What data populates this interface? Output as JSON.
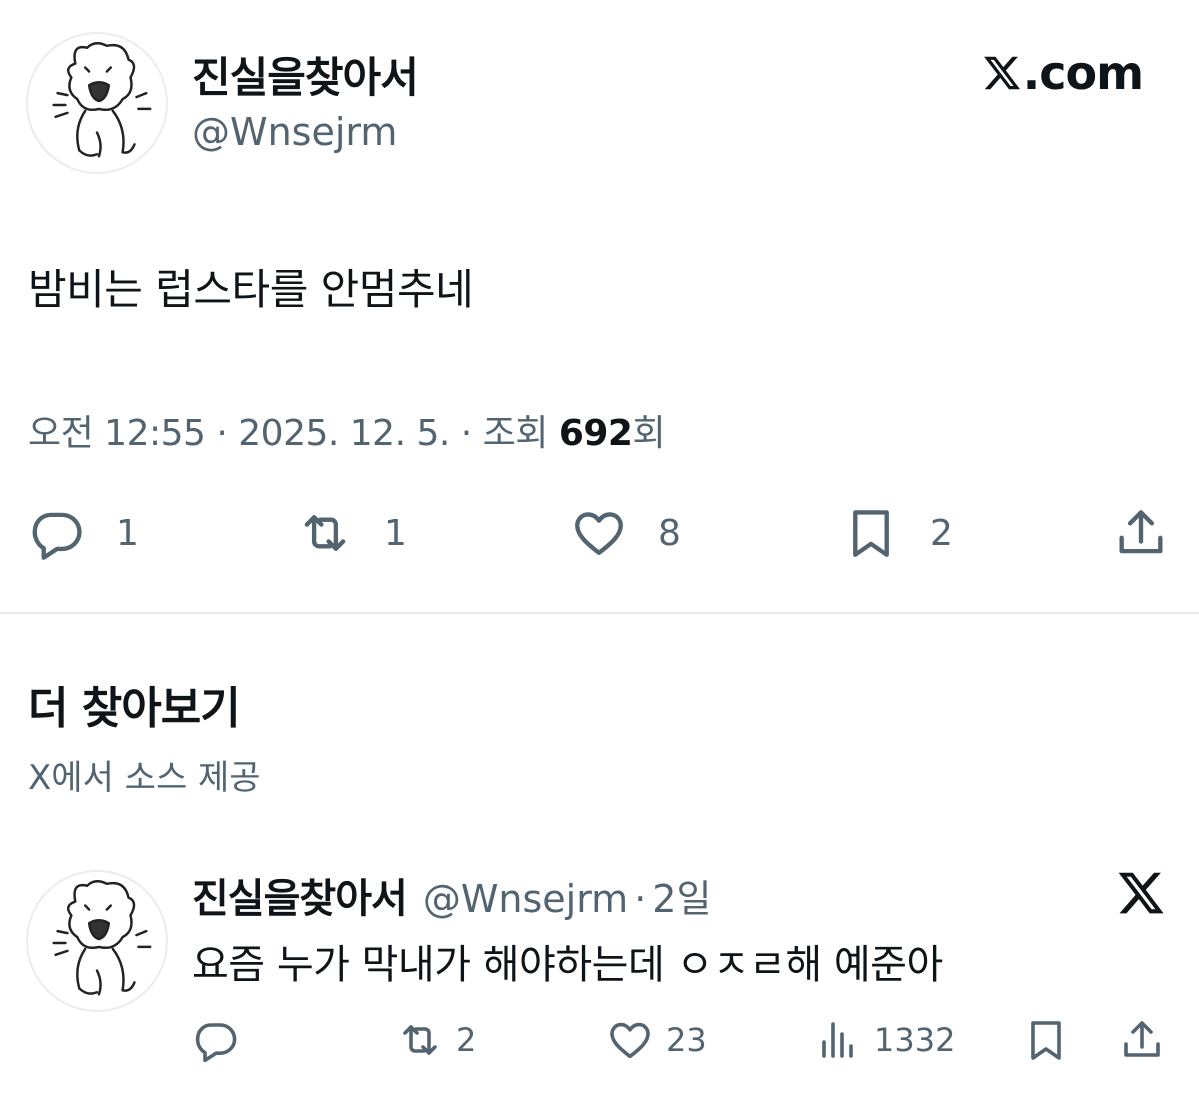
{
  "tweet": {
    "author_name": "진실을찾아서",
    "author_handle": "@Wnsejrm",
    "brand": ".com",
    "text": "밤비는 럽스타를 안멈추네",
    "meta_prefix": "오전 12:55 · 2025. 12. 5. · 조회 ",
    "views": "692",
    "views_suffix": "회",
    "counts": {
      "replies": "1",
      "reposts": "1",
      "likes": "8",
      "bookmarks": "2"
    },
    "icons": [
      "reply-icon",
      "repost-icon",
      "like-icon",
      "bookmark-icon",
      "share-icon"
    ]
  },
  "discover": {
    "title": "더 찾아보기",
    "subtitle": "X에서 소스 제공"
  },
  "related_tweet": {
    "author_name": "진실을찾아서",
    "author_handle": "@Wnsejrm",
    "separator": "·",
    "time": "2일",
    "text": "요즘 누가 막내가 해야하는데 ㅇㅈㄹ해 예준아",
    "counts": {
      "reposts": "2",
      "likes": "23",
      "views": "1332"
    },
    "icons": [
      "reply-icon",
      "repost-icon",
      "like-icon",
      "views-icon",
      "bookmark-icon",
      "share-icon",
      "x-logo-icon"
    ]
  },
  "colors": {
    "text_primary": "#0f1419",
    "text_secondary": "#536471",
    "divider": "#e6e9ec",
    "background": "#ffffff"
  }
}
